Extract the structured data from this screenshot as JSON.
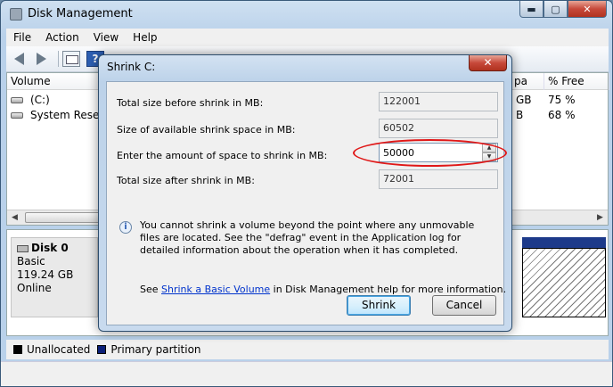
{
  "window": {
    "title": "Disk Management",
    "caption": {
      "minimize": "▬",
      "maximize": "▢",
      "close": "✕"
    }
  },
  "menu": [
    "File",
    "Action",
    "View",
    "Help"
  ],
  "toolbar": {
    "help_label": "?"
  },
  "volume_list": {
    "headers": {
      "volume": "Volume",
      "capacity_fragment": "pa",
      "free_pct": "% Free"
    },
    "rows": [
      {
        "volume": "(C:)",
        "capacity_fragment": "GB",
        "free_pct": "75 %"
      },
      {
        "volume": "System Reserve",
        "capacity_fragment": "B",
        "free_pct": "68 %"
      }
    ]
  },
  "disk": {
    "name": "Disk 0",
    "type": "Basic",
    "size": "119.24 GB",
    "status": "Online"
  },
  "legend": [
    {
      "label": "Unallocated",
      "color": "#000000"
    },
    {
      "label": "Primary partition",
      "color": "#0b1f78"
    }
  ],
  "dialog": {
    "title": "Shrink C:",
    "close": "✕",
    "total_before_label": "Total size before shrink in MB:",
    "total_before_value": "122001",
    "available_label": "Size of available shrink space in MB:",
    "available_value": "60502",
    "amount_label": "Enter the amount of space to shrink in MB:",
    "amount_value": "50000",
    "total_after_label": "Total size after shrink in MB:",
    "total_after_value": "72001",
    "info_text": "You cannot shrink a volume beyond the point where any unmovable files are located. See the \"defrag\" event in the Application log for detailed information about the operation when it has completed.",
    "see_prefix": "See ",
    "see_link": "Shrink a Basic Volume",
    "see_suffix": " in Disk Management help for more information.",
    "shrink_button": "Shrink",
    "cancel_button": "Cancel"
  }
}
